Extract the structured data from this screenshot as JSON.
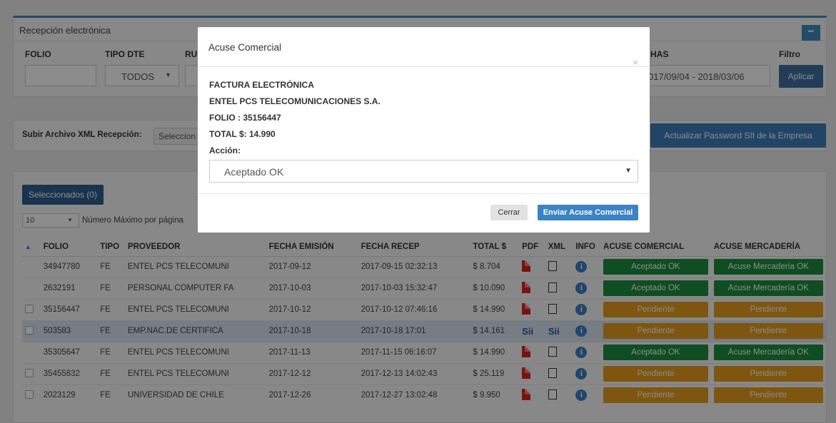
{
  "panel1": {
    "title": "Recepción electrónica",
    "minus": "−",
    "folio_label": "FOLIO",
    "tipo_label": "TIPO DTE",
    "rut_label": "RU",
    "fechas_label": "HAS",
    "filtro_label": "Filtro",
    "tipo_value": "TODOS",
    "fechas_value": "017/09/04 - 2018/03/06",
    "aplicar": "Aplicar"
  },
  "panel2": {
    "upload_label": "Subir Archivo XML Recepción:",
    "select_btn": "Seleccion",
    "password_btn": "Actualizar Password SII de la Empresa"
  },
  "panel3": {
    "selected_btn": "Seleccionados (0)",
    "page_size": "10",
    "page_size_label": "Número Máximo por página"
  },
  "table": {
    "columns": [
      "FOLIO",
      "TIPO",
      "PROVEEDOR",
      "FECHA EMISIÓN",
      "FECHA RECEP",
      "TOTAL $",
      "PDF",
      "XML",
      "INFO",
      "ACUSE COMERCIAL",
      "ACUSE MERCADERÍA"
    ],
    "rows": [
      {
        "folio": "34947780",
        "tipo": "FE",
        "proveedor": "ENTEL PCS TELECOMUNI",
        "emision": "2017-09-12",
        "recep": "2017-09-15 02:32:13",
        "total": "$ 8.704",
        "comercial": "Aceptado OK",
        "mercaderia": "Acuse Mercadería OK"
      },
      {
        "folio": "2632191",
        "tipo": "FE",
        "proveedor": "PERSONAL COMPUTER FA",
        "emision": "2017-10-03",
        "recep": "2017-10-03 15:32:47",
        "total": "$ 10.090",
        "comercial": "Aceptado OK",
        "mercaderia": "Acuse Mercadería OK"
      },
      {
        "folio": "35156447",
        "tipo": "FE",
        "proveedor": "ENTEL PCS TELECOMUNI",
        "emision": "2017-10-12",
        "recep": "2017-10-12 07:46:16",
        "total": "$ 14.990",
        "comercial": "Pendiente",
        "mercaderia": "Pendiente"
      },
      {
        "folio": "503583",
        "tipo": "FE",
        "proveedor": "EMP.NAC.DE CERTIFICA",
        "emision": "2017-10-18",
        "recep": "2017-10-18 17:01",
        "total": "$ 14.161",
        "comercial": "Pendiente",
        "mercaderia": "Pendiente",
        "sii": "Sii"
      },
      {
        "folio": "35305647",
        "tipo": "FE",
        "proveedor": "ENTEL PCS TELECOMUNI",
        "emision": "2017-11-13",
        "recep": "2017-11-15 06:16:07",
        "total": "$ 14.990",
        "comercial": "Aceptado OK",
        "mercaderia": "Acuse Mercadería OK"
      },
      {
        "folio": "35455832",
        "tipo": "FE",
        "proveedor": "ENTEL PCS TELECOMUNI",
        "emision": "2017-12-12",
        "recep": "2017-12-13 14:02:43",
        "total": "$ 25.119",
        "comercial": "Pendiente",
        "mercaderia": "Pendiente"
      },
      {
        "folio": "2023129",
        "tipo": "FE",
        "proveedor": "UNIVERSIDAD DE CHILE",
        "emision": "2017-12-26",
        "recep": "2017-12-27 13:02:48",
        "total": "$ 9.950",
        "comercial": "Pendiente",
        "mercaderia": "Pendiente"
      }
    ]
  },
  "modal": {
    "title": "Acuse Comercial",
    "close": "×",
    "doc_type": "FACTURA ELECTRÓNICA",
    "company": "ENTEL PCS TELECOMUNICACIONES S.A.",
    "folio": "FOLIO : 35156447",
    "total": "TOTAL $: 14.990",
    "accion_label": "Acción:",
    "accion_value": "Aceptado OK",
    "cerrar": "Cerrar",
    "enviar": "Enviar Acuse Comercial"
  },
  "colors": {
    "primary": "#3c8dbc",
    "ok": "#1a8f3c",
    "pending": "#e59d1c"
  }
}
